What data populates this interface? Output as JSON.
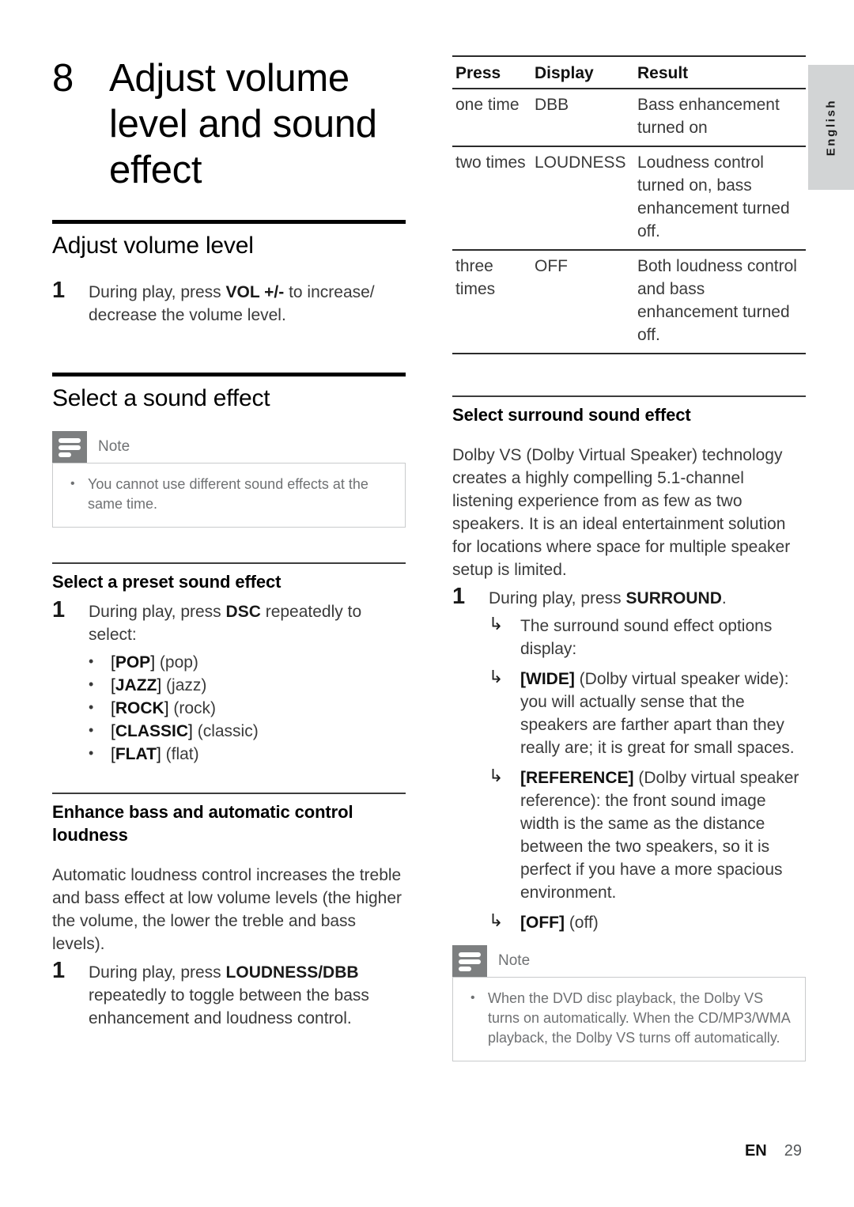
{
  "language_tab": {
    "label": "English"
  },
  "chapter": {
    "number": "8",
    "title": "Adjust volume level and sound effect"
  },
  "left_column": {
    "section_volume": {
      "heading": "Adjust volume level",
      "step": {
        "number": "1",
        "text_before": "During play, press ",
        "emphasis": "VOL +/-",
        "text_after": " to increase/ decrease the volume level."
      }
    },
    "section_sound_effect": {
      "heading": "Select a sound effect",
      "note": {
        "title": "Note",
        "items": [
          "You cannot use different sound effects at the same time."
        ]
      },
      "preset": {
        "heading": "Select a preset sound effect",
        "step": {
          "number": "1",
          "text_before": "During play, press ",
          "emphasis": "DSC",
          "text_after": " repeatedly to select:"
        },
        "options": [
          {
            "code": "POP",
            "desc": "(pop)"
          },
          {
            "code": "JAZZ",
            "desc": "(jazz)"
          },
          {
            "code": "ROCK",
            "desc": "(rock)"
          },
          {
            "code": "CLASSIC",
            "desc": "(classic)"
          },
          {
            "code": "FLAT",
            "desc": "(flat)"
          }
        ]
      },
      "bass": {
        "heading": "Enhance bass and automatic control loudness",
        "paragraph": "Automatic loudness control increases the treble and bass effect at low volume levels (the higher the volume, the lower the treble and bass levels).",
        "step": {
          "number": "1",
          "text_before": "During play, press ",
          "emphasis": "LOUDNESS/DBB",
          "text_after": " repeatedly to toggle between the bass enhancement and loudness control."
        }
      }
    }
  },
  "right_column": {
    "table": {
      "headers": [
        "Press",
        "Display",
        "Result"
      ],
      "rows": [
        [
          "one time",
          "DBB",
          "Bass enhancement turned on"
        ],
        [
          "two times",
          "LOUDNESS",
          "Loudness control turned on, bass enhancement turned off."
        ],
        [
          "three times",
          "OFF",
          "Both loudness control and bass enhancement turned off."
        ]
      ]
    },
    "surround": {
      "heading": "Select surround sound effect",
      "paragraph": "Dolby VS (Dolby Virtual Speaker) technology creates a highly compelling 5.1-channel listening experience from as few as two speakers. It is an ideal entertainment solution for locations where space for multiple speaker setup is limited.",
      "step": {
        "number": "1",
        "text_before": "During play, press ",
        "emphasis": "SURROUND",
        "text_after": "."
      },
      "results": [
        {
          "code": "",
          "text": "The surround sound effect options display:"
        },
        {
          "code": "[WIDE]",
          "text": " (Dolby virtual speaker wide): you will actually sense that the speakers are farther apart than they really are; it is great for small spaces."
        },
        {
          "code": "[REFERENCE]",
          "text": " (Dolby virtual speaker reference): the front sound image width is the same as the distance between the two speakers, so it is perfect if you have a more spacious environment."
        },
        {
          "code": "[OFF]",
          "text": " (off)"
        }
      ],
      "note": {
        "title": "Note",
        "items": [
          "When the DVD disc playback, the Dolby VS turns on automatically. When the CD/MP3/WMA playback, the Dolby VS turns off automatically."
        ]
      }
    }
  },
  "footer": {
    "lang_code": "EN",
    "page_number": "29"
  }
}
